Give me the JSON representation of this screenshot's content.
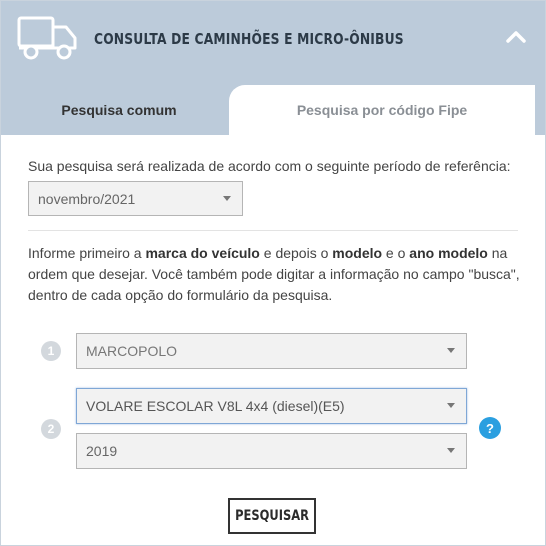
{
  "header": {
    "title": "CONSULTA DE CAMINHÕES E MICRO-ÔNIBUS",
    "icon": "truck-icon",
    "collapse_icon": "chevron-up-icon"
  },
  "tabs": [
    {
      "label": "Pesquisa comum",
      "active": true
    },
    {
      "label": "Pesquisa por código Fipe",
      "active": false
    }
  ],
  "period": {
    "text": "Sua pesquisa será realizada de acordo com o seguinte período de referência:",
    "selected": "novembro/2021"
  },
  "instructions": {
    "p1": "Informe primeiro a ",
    "b1": "marca do veículo",
    "p2": " e depois o ",
    "b2": "modelo",
    "p3": " e o ",
    "b3": "ano modelo",
    "p4": " na ordem que desejar. Você também pode digitar a informação no campo \"busca\", dentro de cada opção do formulário da pesquisa."
  },
  "steps": {
    "step1": "1",
    "step2": "2"
  },
  "form": {
    "brand": "MARCOPOLO",
    "model": "VOLARE ESCOLAR V8L 4x4 (diesel)(E5)",
    "year": "2019",
    "help_label": "?"
  },
  "actions": {
    "search_label": "PESQUISAR"
  },
  "colors": {
    "header_bg": "#bccbda",
    "help_blue": "#2b9fe0"
  }
}
